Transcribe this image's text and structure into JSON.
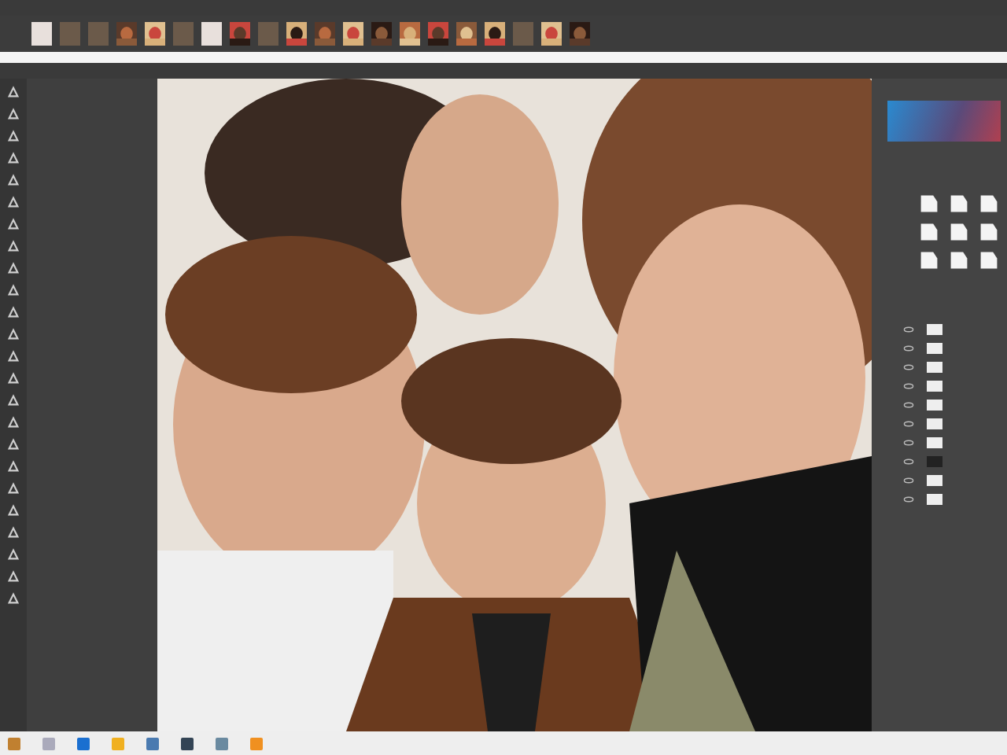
{
  "thumbnails": [
    {
      "kind": "swatch"
    },
    {
      "kind": "swatch"
    },
    {
      "kind": "swatch"
    },
    {
      "kind": "picture"
    },
    {
      "kind": "picture"
    },
    {
      "kind": "swatch"
    },
    {
      "kind": "swatch"
    },
    {
      "kind": "picture"
    },
    {
      "kind": "swatch"
    },
    {
      "kind": "picture"
    },
    {
      "kind": "picture"
    },
    {
      "kind": "picture"
    },
    {
      "kind": "picture"
    },
    {
      "kind": "picture"
    },
    {
      "kind": "picture"
    },
    {
      "kind": "picture"
    },
    {
      "kind": "picture"
    },
    {
      "kind": "swatch"
    },
    {
      "kind": "picture"
    },
    {
      "kind": "picture"
    }
  ],
  "canvas": {
    "kind": "picture"
  },
  "layers": [
    {
      "visible": true
    },
    {
      "visible": true
    },
    {
      "visible": true
    },
    {
      "visible": true
    },
    {
      "visible": true
    },
    {
      "visible": true
    },
    {
      "visible": true
    },
    {
      "visible": true
    },
    {
      "visible": true
    },
    {
      "visible": true
    }
  ]
}
